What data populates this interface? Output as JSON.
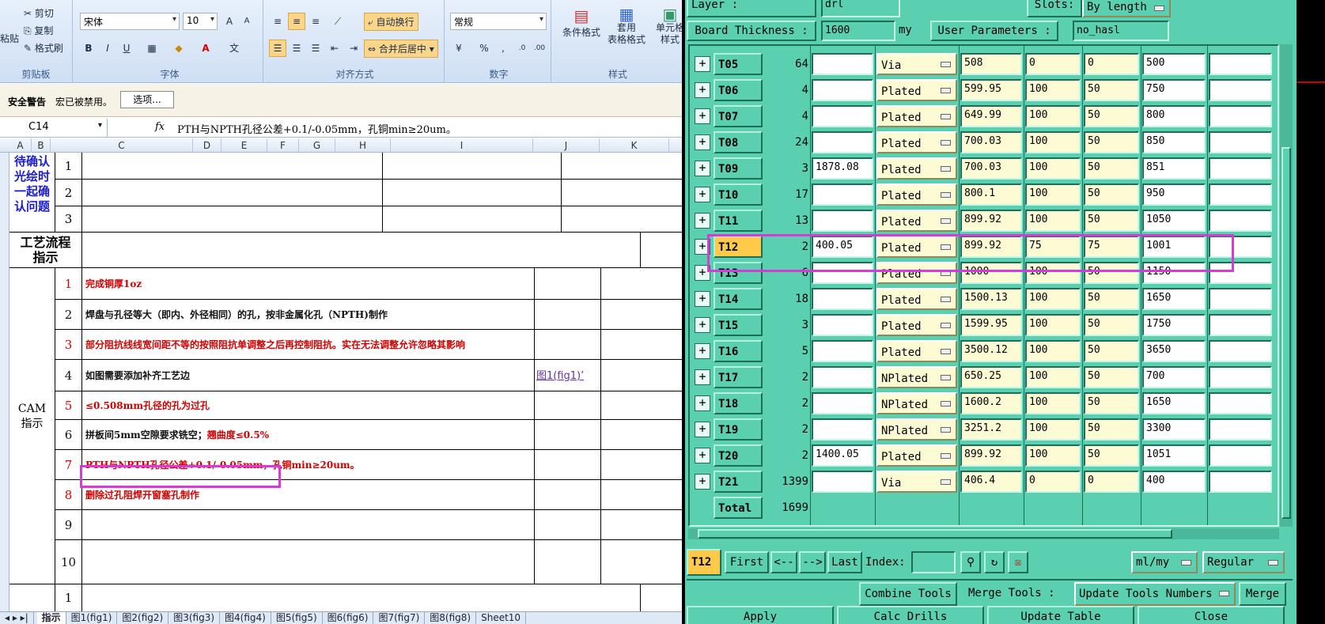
{
  "excel": {
    "ribbon": {
      "clipboard": {
        "paste": "粘贴",
        "cut": "剪切",
        "copy": "复制",
        "format_painter": "格式刷",
        "label": "剪贴板"
      },
      "font": {
        "name": "宋体",
        "size": "10",
        "label": "字体",
        "bold": "B",
        "italic": "I",
        "underline": "U"
      },
      "align": {
        "wrap": "自动换行",
        "merge": "合并后居中",
        "label": "对齐方式"
      },
      "number": {
        "format": "常规",
        "percent": "%",
        "comma": ",",
        "label": "数字"
      },
      "styles": {
        "cond": "条件格式",
        "table_fmt": "套用\n表格格式",
        "cell_style": "单元格\n样式",
        "label": "样式"
      }
    },
    "security": {
      "title": "安全警告",
      "message": "宏已被禁用。",
      "options": "选项..."
    },
    "formula_bar": {
      "cell_ref": "C14",
      "fx": "fx",
      "content": "PTH与NPTH孔径公差+0.1/-0.05mm，孔铜min≥20um。"
    },
    "columns": [
      "A",
      "B",
      "C",
      "D",
      "E",
      "F",
      "G",
      "H",
      "I",
      "J",
      "K"
    ],
    "rows": {
      "confirm_label": "待确认光绘时一起确认问题",
      "confirm_nums": [
        "1",
        "2",
        "3"
      ],
      "process_label": "工艺流程指示",
      "cam_label": "CAM\n指示",
      "cam_items": [
        {
          "n": "1",
          "text": "完成铜厚1oz",
          "color": "#d30000"
        },
        {
          "n": "2",
          "text": "焊盘与孔径等大（即内、外径相同）的孔，按非金属化孔（NPTH)制作",
          "color": "#111111"
        },
        {
          "n": "3",
          "text": "部分阻抗线线宽间距不等的按照阻抗单调整之后再控制阻抗。实在无法调整允许忽略其影响",
          "color": "#d30000"
        },
        {
          "n": "4",
          "text": "如图需要添加补齐工艺边",
          "color": "#111111"
        },
        {
          "n": "5",
          "text": "≤0.508mm孔径的孔为过孔",
          "color": "#d30000"
        },
        {
          "n": "6",
          "text": "拼板间5mm空隙要求铣空；",
          "color": "#111111"
        },
        {
          "n": "7",
          "text": "PTH与NPTH孔径公差+0.1/-0.05mm，孔铜min≥20um。",
          "color": "#d30000"
        },
        {
          "n": "8",
          "text": "删除过孔阻焊开窗塞孔制作",
          "color": "#d30000"
        },
        {
          "n": "9",
          "text": "",
          "color": "#111111"
        },
        {
          "n": "10",
          "text": "",
          "color": "#111111"
        }
      ],
      "item6_extra": "翘曲度≤0.5%",
      "fig_link": "图1(fig1)’",
      "last_num": "1"
    },
    "sheet_tabs": [
      "指示",
      "图1(fig1)",
      "图2(fig2)",
      "图3(fig3)",
      "图4(fig4)",
      "图5(fig5)",
      "图6(fig6)",
      "图7(fig7)",
      "图8(fig8)",
      "Sheet10"
    ]
  },
  "tool": {
    "layer_label": "Layer        :",
    "layer_value": "drl",
    "slots_label": "Slots:",
    "slots_value": "By length",
    "thickness_label": "Board Thickness :",
    "thickness_value": "1600",
    "thickness_unit": "my",
    "user_params_label": "User Parameters :",
    "user_params_value": "no_hasl",
    "rows": [
      {
        "name": "T05",
        "count": "64",
        "f1": "",
        "type": "Via",
        "v1": "508",
        "v2": "0",
        "v3": "0",
        "v4": "500"
      },
      {
        "name": "T06",
        "count": "4",
        "f1": "",
        "type": "Plated",
        "v1": "599.95",
        "v2": "100",
        "v3": "50",
        "v4": "750"
      },
      {
        "name": "T07",
        "count": "4",
        "f1": "",
        "type": "Plated",
        "v1": "649.99",
        "v2": "100",
        "v3": "50",
        "v4": "800"
      },
      {
        "name": "T08",
        "count": "24",
        "f1": "",
        "type": "Plated",
        "v1": "700.03",
        "v2": "100",
        "v3": "50",
        "v4": "850"
      },
      {
        "name": "T09",
        "count": "3",
        "f1": "1878.08",
        "type": "Plated",
        "v1": "700.03",
        "v2": "100",
        "v3": "50",
        "v4": "851"
      },
      {
        "name": "T10",
        "count": "17",
        "f1": "",
        "type": "Plated",
        "v1": "800.1",
        "v2": "100",
        "v3": "50",
        "v4": "950"
      },
      {
        "name": "T11",
        "count": "13",
        "f1": "",
        "type": "Plated",
        "v1": "899.92",
        "v2": "100",
        "v3": "50",
        "v4": "1050"
      },
      {
        "name": "T12",
        "count": "2",
        "f1": "400.05",
        "type": "Plated",
        "v1": "899.92",
        "v2": "75",
        "v3": "75",
        "v4": "1001"
      },
      {
        "name": "T13",
        "count": "6",
        "f1": "",
        "type": "Plated",
        "v1": "1000",
        "v2": "100",
        "v3": "50",
        "v4": "1150"
      },
      {
        "name": "T14",
        "count": "18",
        "f1": "",
        "type": "Plated",
        "v1": "1500.13",
        "v2": "100",
        "v3": "50",
        "v4": "1650"
      },
      {
        "name": "T15",
        "count": "3",
        "f1": "",
        "type": "Plated",
        "v1": "1599.95",
        "v2": "100",
        "v3": "50",
        "v4": "1750"
      },
      {
        "name": "T16",
        "count": "5",
        "f1": "",
        "type": "Plated",
        "v1": "3500.12",
        "v2": "100",
        "v3": "50",
        "v4": "3650"
      },
      {
        "name": "T17",
        "count": "2",
        "f1": "",
        "type": "NPlated",
        "v1": "650.25",
        "v2": "100",
        "v3": "50",
        "v4": "700"
      },
      {
        "name": "T18",
        "count": "2",
        "f1": "",
        "type": "NPlated",
        "v1": "1600.2",
        "v2": "100",
        "v3": "50",
        "v4": "1650"
      },
      {
        "name": "T19",
        "count": "2",
        "f1": "",
        "type": "NPlated",
        "v1": "3251.2",
        "v2": "100",
        "v3": "50",
        "v4": "3300"
      },
      {
        "name": "T20",
        "count": "2",
        "f1": "1400.05",
        "type": "Plated",
        "v1": "899.92",
        "v2": "100",
        "v3": "50",
        "v4": "1051"
      },
      {
        "name": "T21",
        "count": "1399",
        "f1": "",
        "type": "Via",
        "v1": "406.4",
        "v2": "0",
        "v3": "0",
        "v4": "400"
      }
    ],
    "total_label": "Total",
    "total_value": "1699",
    "nav": {
      "current": "T12",
      "first": "First",
      "prev": "<--",
      "next": "-->",
      "last": "Last",
      "index_label": "Index:",
      "unit": "ml/my",
      "mode": "Regular"
    },
    "combine": "Combine Tools",
    "merge_label": "Merge Tools :",
    "update_numbers": "Update Tools Numbers",
    "merge": "Merge",
    "apply": "Apply",
    "calc": "Calc Drills",
    "update_table": "Update Table",
    "close": "Close",
    "highlight_color": "#d63bd6"
  }
}
